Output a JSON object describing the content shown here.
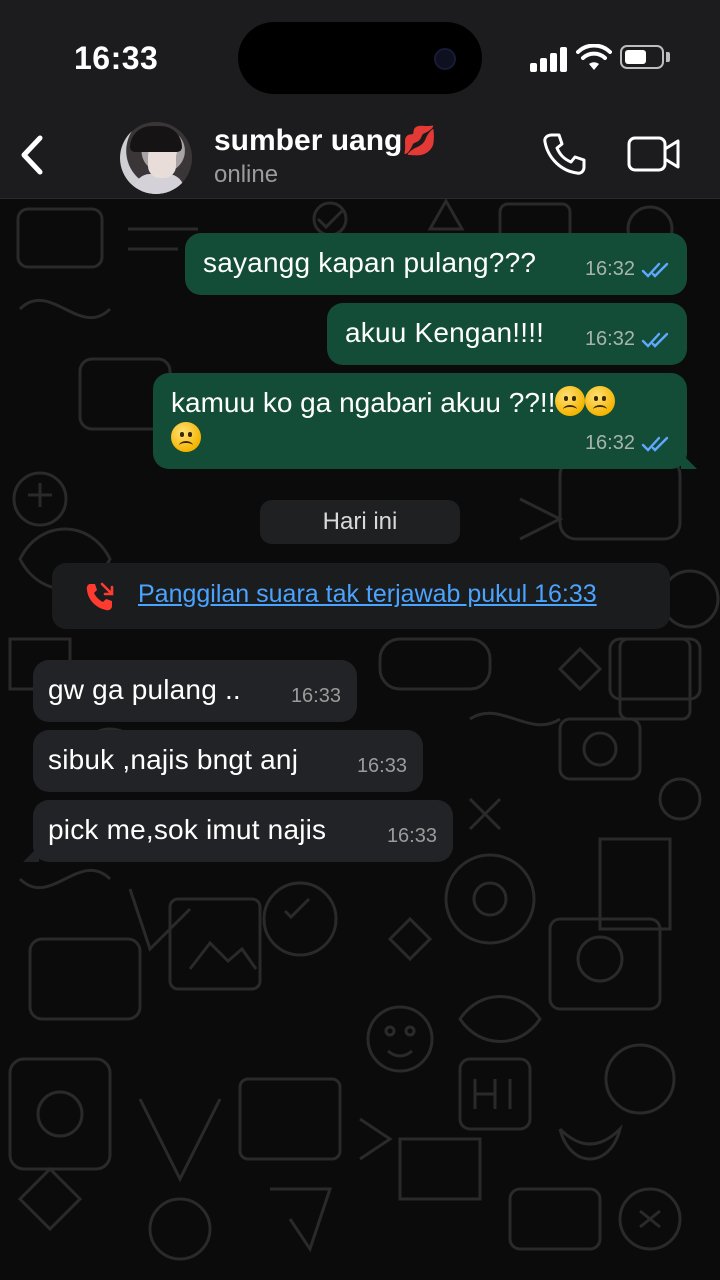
{
  "status_bar": {
    "time": "16:33",
    "battery_level": 0.62
  },
  "header": {
    "contact_name": "sumber uang",
    "name_emoji": "💋",
    "contact_status": "online"
  },
  "messages": [
    {
      "direction": "out",
      "text": "sayangg kapan pulang???",
      "time": "16:32",
      "read": true
    },
    {
      "direction": "out",
      "text": "akuu Kengan!!!!",
      "time": "16:32",
      "read": true
    },
    {
      "direction": "out",
      "text": "kamuu ko ga ngabari akuu ??!!",
      "emoji_count": 3,
      "time": "16:32",
      "read": true
    },
    {
      "direction": "in",
      "text": "gw ga pulang ..",
      "time": "16:33"
    },
    {
      "direction": "in",
      "text": "sibuk ,najis bngt anj",
      "time": "16:33"
    },
    {
      "direction": "in",
      "text": "pick me,sok imut najis",
      "time": "16:33"
    }
  ],
  "day_separator": "Hari ini",
  "missed_call": {
    "text": "Panggilan suara tak terjawab pukul 16:33",
    "icon": "missed-call-icon"
  },
  "colors": {
    "outgoing_bubble": "#134d37",
    "incoming_bubble": "#222326",
    "read_ticks": "#5fa8ff",
    "link": "#4aa3ff",
    "missed_call": "#ff3b30"
  }
}
